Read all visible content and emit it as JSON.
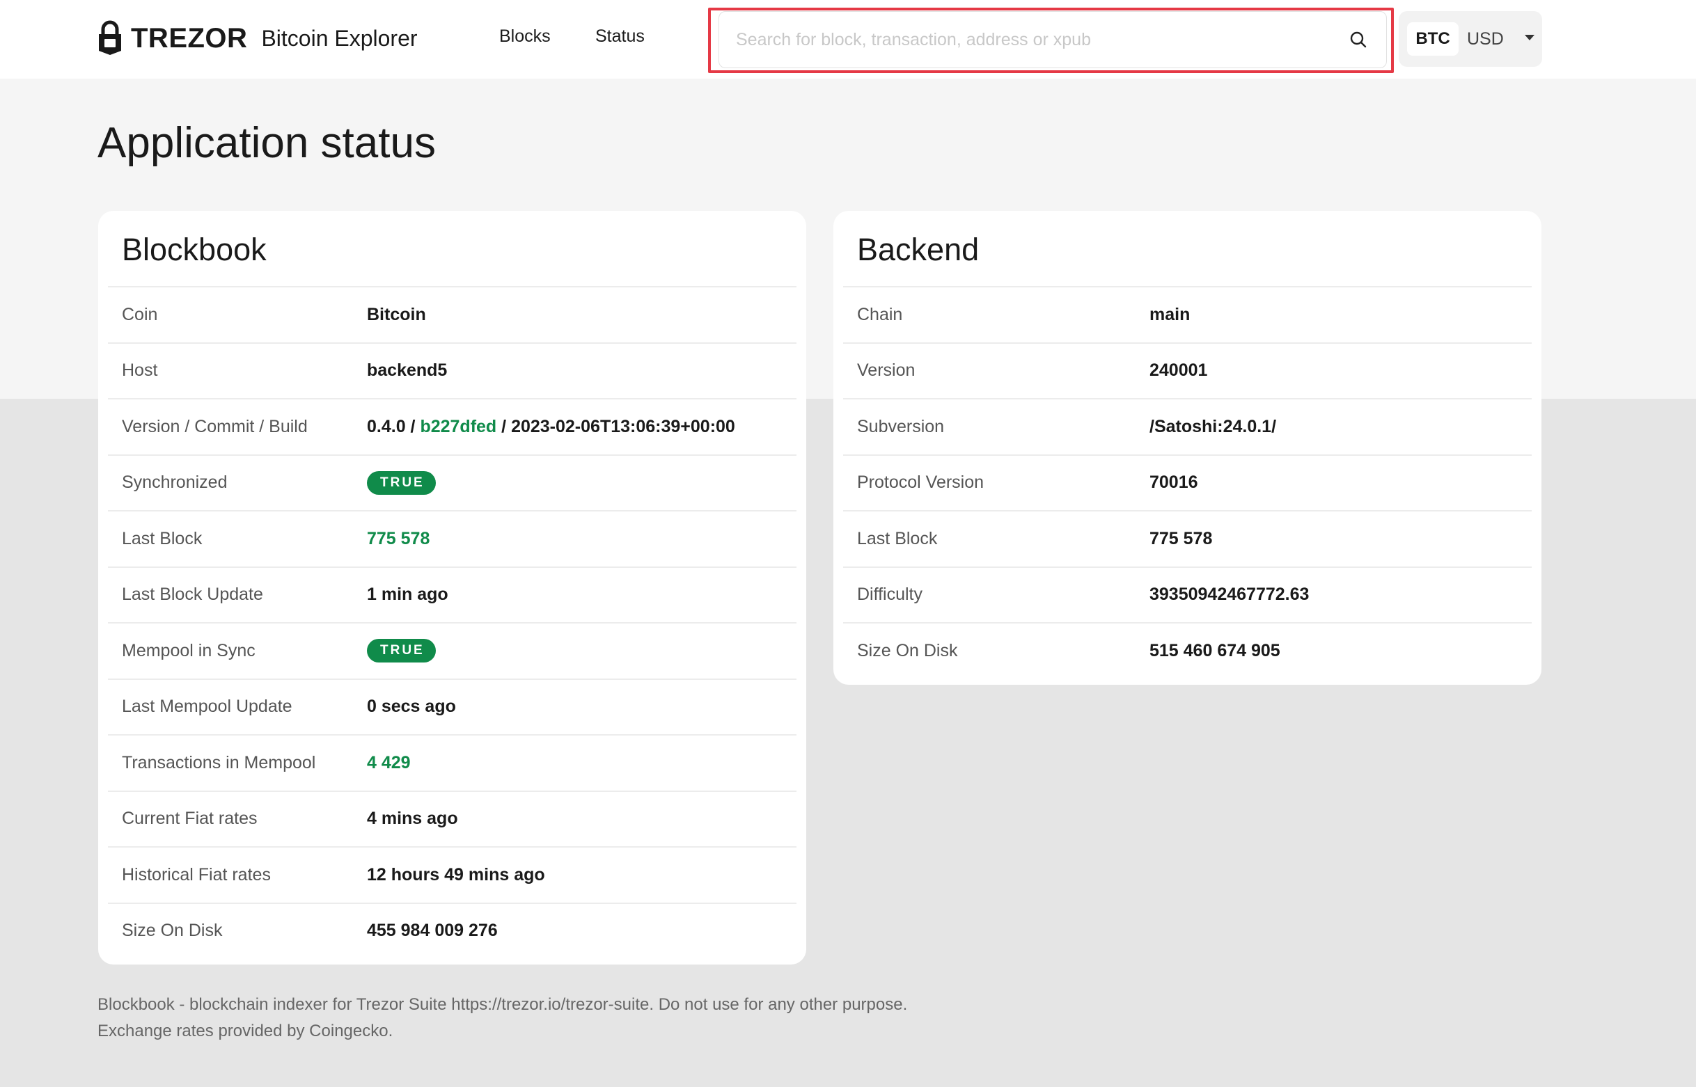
{
  "header": {
    "brand": "TREZOR",
    "product": "Bitcoin Explorer",
    "nav": [
      {
        "label": "Blocks"
      },
      {
        "label": "Status"
      }
    ],
    "search": {
      "placeholder": "Search for block, transaction, address or xpub",
      "value": ""
    },
    "currency": {
      "primary": "BTC",
      "secondary": "USD"
    }
  },
  "page": {
    "title": "Application status"
  },
  "blockbook": {
    "title": "Blockbook",
    "coin": {
      "label": "Coin",
      "value": "Bitcoin"
    },
    "host": {
      "label": "Host",
      "value": "backend5"
    },
    "version": {
      "label": "Version / Commit / Build",
      "version": "0.4.0",
      "sep1": " / ",
      "commit": "b227dfed",
      "sep2": " / ",
      "build": "2023-02-06T13:06:39+00:00"
    },
    "synchronized": {
      "label": "Synchronized",
      "value": "TRUE"
    },
    "last_block": {
      "label": "Last Block",
      "value": "775 578"
    },
    "last_block_update": {
      "label": "Last Block Update",
      "value": "1 min ago"
    },
    "mempool_in_sync": {
      "label": "Mempool in Sync",
      "value": "TRUE"
    },
    "last_mempool_update": {
      "label": "Last Mempool Update",
      "value": "0 secs ago"
    },
    "tx_in_mempool": {
      "label": "Transactions in Mempool",
      "value": "4 429"
    },
    "current_fiat": {
      "label": "Current Fiat rates",
      "value": "4 mins ago"
    },
    "historical_fiat": {
      "label": "Historical Fiat rates",
      "value": "12 hours 49 mins ago"
    },
    "size_on_disk": {
      "label": "Size On Disk",
      "value": "455 984 009 276"
    }
  },
  "backend": {
    "title": "Backend",
    "rows": [
      {
        "label": "Chain",
        "value": "main"
      },
      {
        "label": "Version",
        "value": "240001"
      },
      {
        "label": "Subversion",
        "value": "/Satoshi:24.0.1/"
      },
      {
        "label": "Protocol Version",
        "value": "70016"
      },
      {
        "label": "Last Block",
        "value": "775 578"
      },
      {
        "label": "Difficulty",
        "value": "39350942467772.63"
      },
      {
        "label": "Size On Disk",
        "value": "515 460 674 905"
      }
    ]
  },
  "footer": {
    "line1": "Blockbook - blockchain indexer for Trezor Suite https://trezor.io/trezor-suite. Do not use for any other purpose.",
    "line2": "Exchange rates provided by Coingecko."
  },
  "colors": {
    "accent_green": "#108b4a",
    "highlight_red": "#e53945"
  }
}
